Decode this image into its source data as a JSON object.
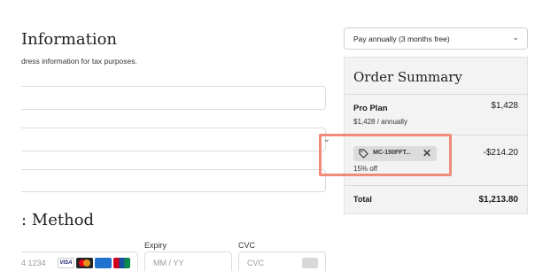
{
  "information": {
    "title": "Information",
    "description": "dress information for tax purposes."
  },
  "payment": {
    "title": ": Method",
    "card_number_placeholder": "4 1234",
    "card_brands": [
      "VISA",
      "Mastercard",
      "AMEX",
      "UnionPay"
    ],
    "expiry_label": "Expiry",
    "expiry_placeholder": "MM / YY",
    "cvc_label": "CVC",
    "cvc_placeholder": "CVC"
  },
  "billing": {
    "selected": "Pay annually (3 months free)"
  },
  "summary": {
    "title": "Order Summary",
    "plan_name": "Pro Plan",
    "plan_price": "$1,428",
    "plan_sub": "$1,428 / annually",
    "coupon_code": "MC-150FFT...",
    "coupon_off": "15% off",
    "discount": "-$214.20",
    "total_label": "Total",
    "total_value": "$1,213.80"
  },
  "colors": {
    "highlight": "#f08b7a",
    "summary_bg": "#f3f3f3"
  }
}
